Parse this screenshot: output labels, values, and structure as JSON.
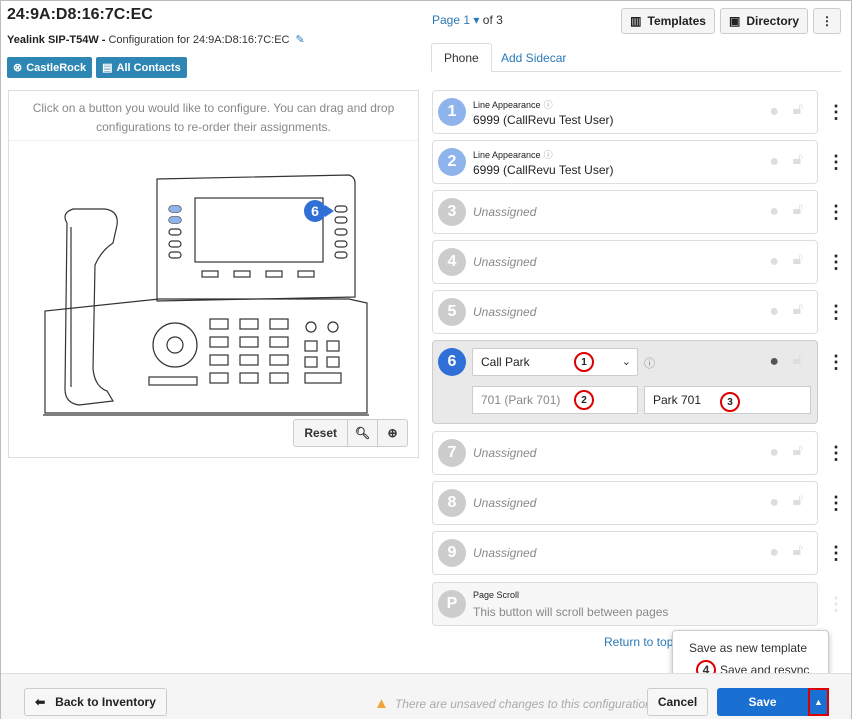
{
  "device": {
    "mac": "24:9A:D8:16:7C:EC",
    "model": "Yealink SIP-T54W -",
    "config_for": "Configuration for 24:9A:D8:16:7C:EC"
  },
  "badges": [
    {
      "label": "CastleRock",
      "icon": "org-icon"
    },
    {
      "label": "All Contacts",
      "icon": "contact-card-icon"
    }
  ],
  "phone_panel": {
    "hint": "Click on a button you would like to configure. You can drag and drop configurations to re-order their assignments.",
    "selected_marker": "6",
    "reset_label": "Reset"
  },
  "pager": {
    "page": "Page 1",
    "of": "of 3"
  },
  "toolbar": {
    "templates_label": "Templates",
    "directory_label": "Directory"
  },
  "tabs": [
    {
      "label": "Phone",
      "active": true
    },
    {
      "label": "Add Sidecar",
      "active": false
    }
  ],
  "keys": [
    {
      "num": "1",
      "type": "Line Appearance",
      "value": "6999 (CallRevu Test User)"
    },
    {
      "num": "2",
      "type": "Line Appearance",
      "value": "6999 (CallRevu Test User)"
    },
    {
      "num": "3",
      "value": "Unassigned"
    },
    {
      "num": "4",
      "value": "Unassigned"
    },
    {
      "num": "5",
      "value": "Unassigned"
    },
    {
      "num": "6",
      "select_value": "Call Park",
      "value_field": "701 (Park 701)",
      "label_field": "Park 701"
    },
    {
      "num": "7",
      "value": "Unassigned"
    },
    {
      "num": "8",
      "value": "Unassigned"
    },
    {
      "num": "9",
      "value": "Unassigned"
    },
    {
      "num": "P",
      "type": "Page Scroll",
      "value": "This button will scroll between pages"
    }
  ],
  "callouts": [
    "1",
    "2",
    "3",
    "4"
  ],
  "return_link": "Return to top",
  "save_menu": {
    "item1": "Save as new template",
    "item2": "Save and resync"
  },
  "footer": {
    "back_label": "Back to Inventory",
    "unsaved_msg": "There are unsaved changes to this configuration",
    "cancel_label": "Cancel",
    "save_label": "Save"
  },
  "colors": {
    "accent": "#1a6fd2",
    "badge": "#2d86b3",
    "callout": "#dd0000",
    "link": "#2a7ab9"
  }
}
